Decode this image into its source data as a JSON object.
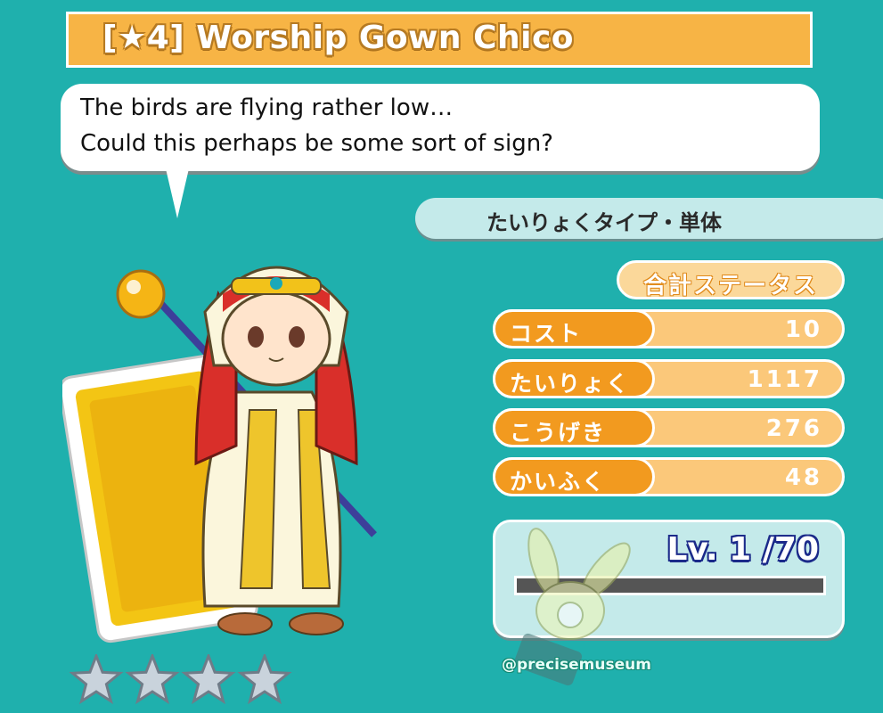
{
  "title": "[★4] Worship Gown Chico",
  "dialogue": {
    "line1": "The birds are flying rather low…",
    "line2": "Could this perhaps be some sort of sign?"
  },
  "type_label": "たいりょくタイプ・単体",
  "total_status_label": "合計ステータス",
  "stats": [
    {
      "label": "コスト",
      "value": "10"
    },
    {
      "label": "たいりょく",
      "value": "1117"
    },
    {
      "label": "こうげき",
      "value": "276"
    },
    {
      "label": "かいふく",
      "value": "48"
    }
  ],
  "level": {
    "text": "Lv. 1 /70",
    "current": 1,
    "max": 70,
    "exp_fraction": 0
  },
  "rarity_stars": 4,
  "watermark": "@precisemuseum",
  "colors": {
    "background": "#1fb0ad",
    "title_bar": "#f7b445",
    "stat_label": "#f29a1f",
    "stat_bar": "#fbc87a",
    "level_text_outline": "#1b2a8a"
  }
}
